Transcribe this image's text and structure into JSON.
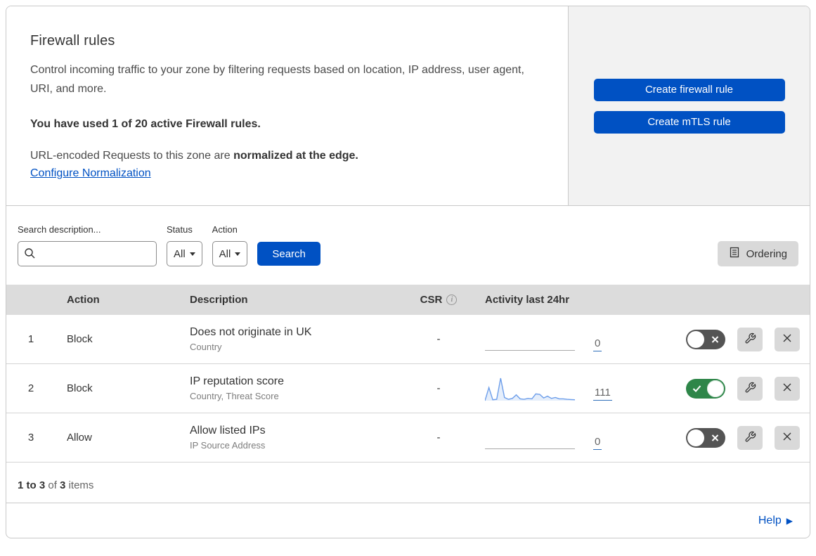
{
  "header": {
    "title": "Firewall rules",
    "description": "Control incoming traffic to your zone by filtering requests based on location, IP address, user agent, URI, and more.",
    "usage": "You have used 1 of 20 active Firewall rules.",
    "normalization_prefix": "URL-encoded Requests to this zone are ",
    "normalization_bold": "normalized at the edge.",
    "normalization_link": "Configure Normalization",
    "buttons": [
      {
        "label": "Create firewall rule"
      },
      {
        "label": "Create mTLS rule"
      }
    ]
  },
  "filters": {
    "search_label": "Search description...",
    "search_value": "",
    "status_label": "Status",
    "status_value": "All",
    "action_label": "Action",
    "action_value": "All",
    "search_button": "Search",
    "ordering_button": "Ordering"
  },
  "table": {
    "columns": {
      "action": "Action",
      "description": "Description",
      "csr": "CSR",
      "activity": "Activity last 24hr"
    },
    "rows": [
      {
        "num": "1",
        "action": "Block",
        "description": "Does not originate in UK",
        "fields": "Country",
        "csr": "-",
        "count": "0",
        "enabled": false,
        "has_sparkline": false
      },
      {
        "num": "2",
        "action": "Block",
        "description": "IP reputation score",
        "fields": "Country, Threat Score",
        "csr": "-",
        "count": "111",
        "enabled": true,
        "has_sparkline": true
      },
      {
        "num": "3",
        "action": "Allow",
        "description": "Allow listed IPs",
        "fields": "IP Source Address",
        "csr": "-",
        "count": "0",
        "enabled": false,
        "has_sparkline": false
      }
    ]
  },
  "footer": {
    "range_bold": "1 to 3",
    "of": "of",
    "total_bold": "3",
    "items": "items"
  },
  "help": {
    "label": "Help"
  },
  "colors": {
    "accent_blue": "#0051c3",
    "panel_gray": "#f2f2f2",
    "header_gray": "#dcdcdc",
    "button_gray": "#d9d9d9",
    "toggle_on_green": "#2e8649",
    "toggle_off_gray": "#545454",
    "sparkline_blue": "#6d9eea"
  },
  "chart_data": {
    "type": "area",
    "context": "activity-sparkline-row-2",
    "title": "Activity last 24hr",
    "x": "24 hourly buckets (last 24hr)",
    "values": [
      0,
      58,
      4,
      6,
      100,
      14,
      6,
      10,
      26,
      8,
      6,
      10,
      8,
      30,
      28,
      12,
      20,
      10,
      14,
      8,
      8,
      6,
      5,
      4
    ],
    "total_events": 111,
    "line_color": "#6d9eea",
    "fill_color": "rgba(109,158,234,0.18)",
    "axes_hidden": true
  }
}
